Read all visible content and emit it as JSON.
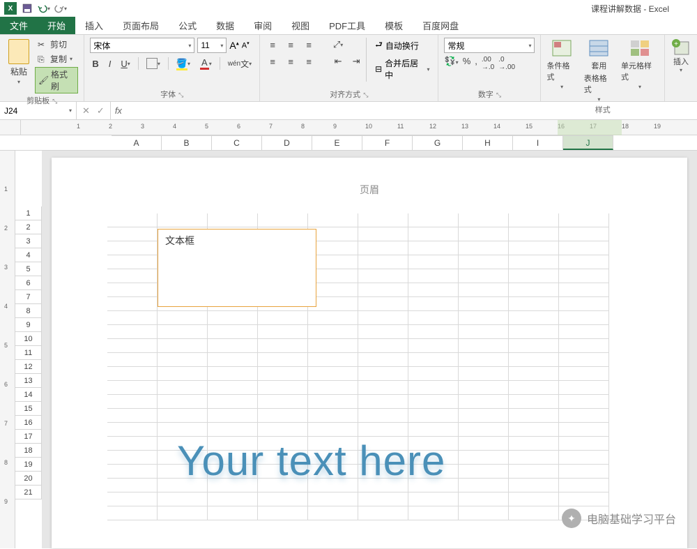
{
  "app": {
    "title": "课程讲解数据 - Excel"
  },
  "qat": {
    "save": "保存",
    "undo": "撤销",
    "redo": "重做"
  },
  "tabs": {
    "file": "文件",
    "home": "开始",
    "insert": "插入",
    "pageLayout": "页面布局",
    "formulas": "公式",
    "data": "数据",
    "review": "审阅",
    "view": "视图",
    "pdf": "PDF工具",
    "template": "模板",
    "baidu": "百度网盘"
  },
  "ribbon": {
    "clipboard": {
      "paste": "粘贴",
      "cut": "剪切",
      "copy": "复制",
      "formatPainter": "格式刷",
      "label": "剪贴板"
    },
    "font": {
      "name": "宋体",
      "size": "11",
      "bold": "B",
      "italic": "I",
      "underline": "U",
      "pinyin": "wén",
      "label": "字体",
      "increase": "A",
      "decrease": "A"
    },
    "alignment": {
      "wrap": "自动换行",
      "merge": "合并后居中",
      "label": "对齐方式"
    },
    "number": {
      "format": "常规",
      "label": "数字"
    },
    "styles": {
      "conditional": "条件格式",
      "tableFormat": "套用",
      "tableFormat2": "表格格式",
      "cellStyles": "单元格样式",
      "label": "样式"
    },
    "cells": {
      "insert": "插入"
    }
  },
  "formulaBar": {
    "nameBox": "J24",
    "fx": "fx"
  },
  "ruler": {
    "ticks": [
      "1",
      "2",
      "3",
      "4",
      "5",
      "6",
      "7",
      "8",
      "9",
      "10",
      "11",
      "12",
      "13",
      "14",
      "15",
      "16",
      "17",
      "18",
      "19"
    ]
  },
  "columns": [
    "A",
    "B",
    "C",
    "D",
    "E",
    "F",
    "G",
    "H",
    "I",
    "J"
  ],
  "rows": [
    "1",
    "2",
    "3",
    "4",
    "5",
    "6",
    "7",
    "8",
    "9",
    "10",
    "11",
    "12",
    "13",
    "14",
    "15",
    "16",
    "17",
    "18",
    "19",
    "20",
    "21"
  ],
  "vruler": [
    "1",
    "2",
    "3",
    "4",
    "5",
    "6",
    "7",
    "8",
    "9"
  ],
  "page": {
    "headerLabel": "页眉",
    "textbox": "文本框",
    "wordart": "Your text here"
  },
  "watermark": {
    "text": "电脑基础学习平台"
  }
}
